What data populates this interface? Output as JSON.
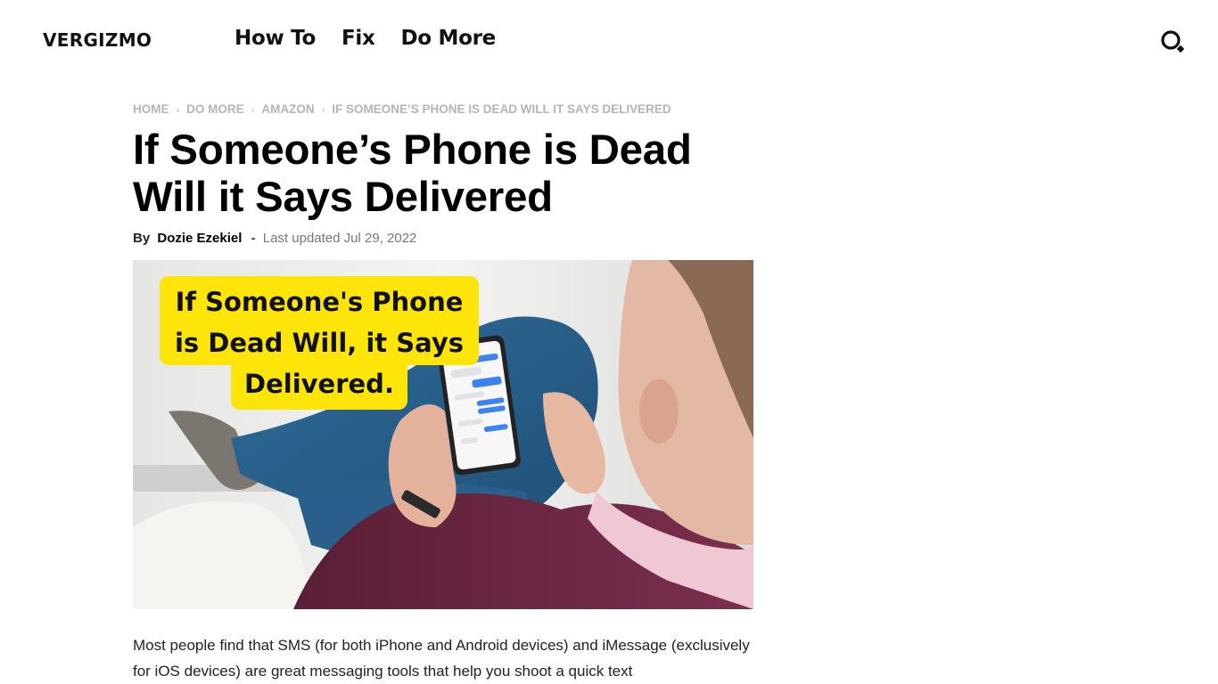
{
  "site": {
    "logo": "VERGIZMO",
    "nav": [
      {
        "label": "How To"
      },
      {
        "label": "Fix"
      },
      {
        "label": "Do More"
      }
    ],
    "search_icon": "search-icon"
  },
  "breadcrumb": {
    "items": [
      {
        "label": "HOME"
      },
      {
        "label": "DO MORE"
      },
      {
        "label": "AMAZON"
      },
      {
        "label": "IF SOMEONE’S PHONE IS DEAD WILL IT SAYS DELIVERED"
      }
    ],
    "separator": "›"
  },
  "article": {
    "title": "If Someone’s Phone is Dead Will it Says Delivered",
    "by_label": "By",
    "author": "Dozie Ezekiel",
    "dash": "-",
    "updated": "Last updated Jul 29, 2022",
    "hero": {
      "caption_lines": [
        "If Someone's Phone",
        "is Dead Will, it Says",
        "Delivered."
      ],
      "caption_bg": "#fde50a",
      "description": "Man sitting on a couch holding a smartphone showing a messaging conversation"
    },
    "paragraph": "Most people find that SMS (for both iPhone and Android devices) and iMessage (exclusively for iOS devices) are great messaging tools that help you shoot a quick text"
  }
}
